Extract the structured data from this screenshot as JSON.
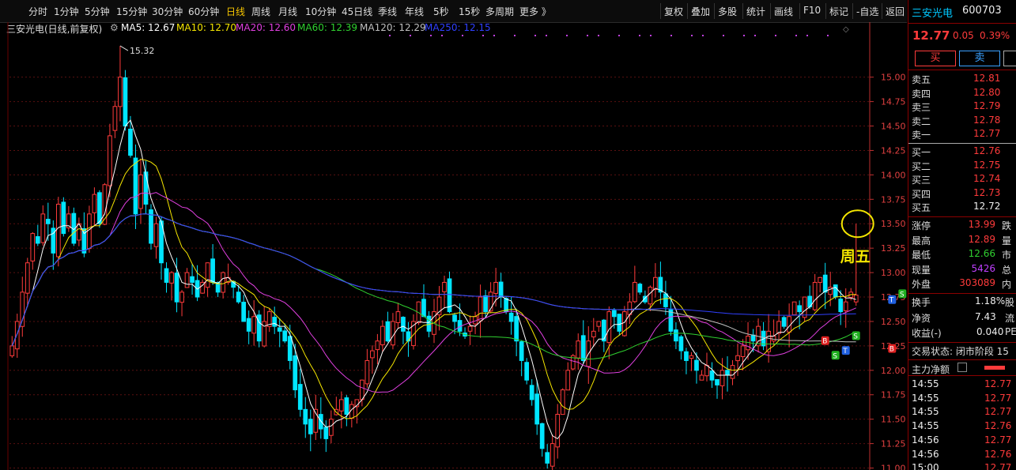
{
  "toolbar": {
    "periods": [
      "分时",
      "1分钟",
      "5分钟",
      "15分钟",
      "30分钟",
      "60分钟",
      "日线",
      "周线",
      "月线",
      "10分钟",
      "45日线",
      "季线",
      "年线",
      "5秒",
      "15秒",
      "多周期",
      "更多 》"
    ],
    "active_period": "日线",
    "tools": [
      "复权",
      "叠加",
      "多股",
      "统计",
      "画线",
      "F10",
      "标记",
      "-自选",
      "返回"
    ]
  },
  "legend": {
    "title": "三安光电(日线,前复权)",
    "ma": [
      {
        "label": "MA5: 12.67",
        "color": "#ffffff"
      },
      {
        "label": "MA10: 12.70",
        "color": "#f5e600"
      },
      {
        "label": "MA20: 12.60",
        "color": "#e040e0"
      },
      {
        "label": "MA60: 12.39",
        "color": "#30d030"
      },
      {
        "label": "MA120: 12.29",
        "color": "#c0c0c0"
      },
      {
        "label": "MA250: 12.15",
        "color": "#3040ff"
      }
    ]
  },
  "chart_data": {
    "type": "candlestick",
    "y_ticks": [
      "15.00",
      "14.75",
      "14.50",
      "14.25",
      "14.00",
      "13.75",
      "13.50",
      "13.25",
      "13.00",
      "12.75",
      "12.50",
      "12.25",
      "12.00",
      "11.75",
      "11.50",
      "11.25",
      "11.00"
    ],
    "ylim": [
      10.98,
      15.45
    ],
    "high_label": "15.32",
    "annotation": "周五",
    "up_color": "#ff3b3b",
    "down_color": "#00e5ff",
    "n_bars": 190,
    "closes": [
      12.25,
      12.5,
      12.8,
      13.1,
      13.4,
      13.3,
      13.6,
      13.5,
      13.2,
      13.7,
      13.4,
      13.6,
      13.3,
      13.5,
      13.2,
      13.6,
      13.8,
      13.5,
      13.9,
      14.4,
      14.7,
      15.0,
      14.5,
      14.2,
      13.6,
      14.0,
      13.7,
      13.3,
      13.5,
      13.1,
      12.9,
      13.0,
      12.7,
      12.8,
      13.0,
      12.9,
      12.75,
      12.9,
      13.1,
      12.9,
      12.8,
      13.0,
      12.95,
      12.85,
      12.7,
      12.5,
      12.4,
      12.55,
      12.3,
      12.5,
      12.6,
      12.45,
      12.4,
      12.3,
      12.1,
      11.8,
      11.6,
      11.45,
      11.35,
      11.6,
      11.4,
      11.3,
      11.5,
      11.6,
      11.7,
      11.55,
      11.65,
      11.7,
      11.9,
      12.1,
      12.2,
      12.3,
      12.45,
      12.3,
      12.5,
      12.6,
      12.4,
      12.3,
      12.5,
      12.7,
      12.55,
      12.4,
      12.6,
      12.75,
      12.9,
      12.6,
      12.5,
      12.4,
      12.35,
      12.45,
      12.55,
      12.75,
      12.6,
      12.8,
      12.9,
      12.75,
      12.6,
      12.5,
      12.3,
      12.1,
      11.9,
      11.7,
      11.45,
      11.2,
      11.05,
      11.25,
      11.55,
      11.8,
      12.0,
      12.15,
      12.3,
      12.1,
      12.3,
      12.4,
      12.5,
      12.3,
      12.6,
      12.55,
      12.4,
      12.6,
      12.7,
      12.9,
      12.8,
      12.7,
      12.85,
      12.95,
      12.8,
      12.65,
      12.4,
      12.3,
      12.2,
      12.1,
      12.15,
      12.0,
      11.95,
      12.05,
      11.9,
      11.85,
      12.0,
      11.95,
      12.05,
      12.15,
      12.25,
      12.35,
      12.3,
      12.45,
      12.25,
      12.4,
      12.35,
      12.5,
      12.45,
      12.55,
      12.7,
      12.6,
      12.75,
      12.65,
      12.9,
      12.95,
      12.8,
      12.85,
      12.75,
      12.6,
      12.7,
      12.8,
      12.77
    ]
  },
  "right_panel": {
    "stock_name": "三安光电",
    "stock_code": "600703",
    "price": "12.77",
    "change": "0.05",
    "change_pct": "0.39%",
    "buy_label": "买",
    "sell_label": "卖",
    "asks": [
      {
        "label": "卖五",
        "price": "12.81"
      },
      {
        "label": "卖四",
        "price": "12.80"
      },
      {
        "label": "卖三",
        "price": "12.79"
      },
      {
        "label": "卖二",
        "price": "12.78"
      },
      {
        "label": "卖一",
        "price": "12.77"
      }
    ],
    "bids": [
      {
        "label": "买一",
        "price": "12.76"
      },
      {
        "label": "买二",
        "price": "12.75"
      },
      {
        "label": "买三",
        "price": "12.74"
      },
      {
        "label": "买四",
        "price": "12.73"
      },
      {
        "label": "买五",
        "price": "12.72"
      }
    ],
    "stats": [
      {
        "label": "涨停",
        "value": "13.99",
        "tail": "跌"
      },
      {
        "label": "最高",
        "value": "12.89",
        "tail": "量"
      },
      {
        "label": "最低",
        "value": "12.66",
        "tail": "市"
      },
      {
        "label": "现量",
        "value": "5426",
        "tail": "总"
      },
      {
        "label": "外盘",
        "value": "303089",
        "tail": "内"
      }
    ],
    "stats2": [
      {
        "label": "换手",
        "value": "1.18%",
        "tail": "股"
      },
      {
        "label": "净资",
        "value": "7.43",
        "tail": "流"
      },
      {
        "label": "收益(-)",
        "value": "0.040",
        "tail": "PE"
      }
    ],
    "trade_status": "交易状态: 闭市阶段 15",
    "main_net": "主力净额",
    "ticks": [
      {
        "time": "14:55",
        "price": "12.77"
      },
      {
        "time": "14:55",
        "price": "12.77"
      },
      {
        "time": "14:55",
        "price": "12.77"
      },
      {
        "time": "14:55",
        "price": "12.76"
      },
      {
        "time": "14:56",
        "price": "12.77"
      },
      {
        "time": "14:56",
        "price": "12.76"
      },
      {
        "time": "15:00",
        "price": "12.77"
      }
    ]
  }
}
